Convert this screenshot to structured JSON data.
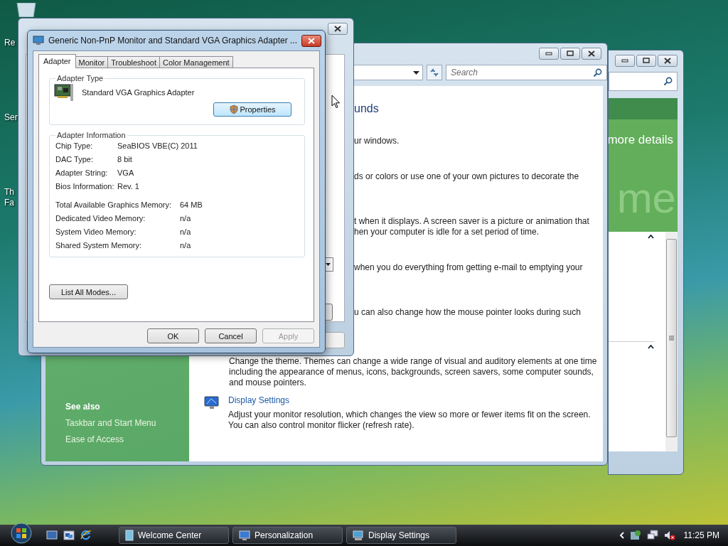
{
  "desktop": {
    "icons": [
      {
        "lines": [
          "Re"
        ]
      },
      {
        "lines": [
          "Ser"
        ]
      },
      {
        "lines": [
          "Th",
          "Fa"
        ]
      }
    ]
  },
  "welcome_window": {
    "banner_link": "more details",
    "banner_title": "me"
  },
  "personalization_window": {
    "search": {
      "placeholder": "Search"
    },
    "heading": "unds",
    "partial_blocks": [
      [
        "ur windows."
      ],
      [
        "ds or colors or use one of your own pictures to decorate the"
      ],
      [
        "t when it displays. A screen saver is a picture or animation that",
        "hen your computer is idle for a set period of time."
      ],
      [
        "when you do everything from getting e-mail to emptying your"
      ],
      [
        "u can also change how the mouse pointer looks during such"
      ]
    ],
    "theme_description": [
      "Change the theme. Themes can change a wide range of visual and auditory elements at one time",
      "including the appearance of menus, icons, backgrounds, screen savers, some computer sounds,",
      "and mouse pointers."
    ],
    "display_settings": {
      "link": "Display Settings",
      "description": [
        "Adjust your monitor resolution, which changes the view so more or fewer items fit on the screen.",
        "You can also control monitor flicker (refresh rate)."
      ]
    },
    "see_also": {
      "title": "See also",
      "links": [
        "Taskbar and Start Menu",
        "Ease of Access"
      ]
    }
  },
  "dialog": {
    "title": "Generic Non-PnP Monitor and Standard VGA Graphics Adapter ...",
    "tabs": [
      {
        "label": "Adapter",
        "selected": true
      },
      {
        "label": "Monitor",
        "selected": false
      },
      {
        "label": "Troubleshoot",
        "selected": false
      },
      {
        "label": "Color Management",
        "selected": false
      }
    ],
    "adapter_type": {
      "group_title": "Adapter Type",
      "name": "Standard VGA Graphics Adapter",
      "properties_button": "Properties"
    },
    "adapter_info": {
      "group_title": "Adapter Information",
      "rows": [
        {
          "label": "Chip Type:",
          "value": "SeaBIOS VBE(C) 2011"
        },
        {
          "label": "DAC Type:",
          "value": "8 bit"
        },
        {
          "label": "Adapter String:",
          "value": "VGA"
        },
        {
          "label": "Bios Information:",
          "value": "Rev. 1"
        }
      ],
      "memory_rows": [
        {
          "label": "Total Available Graphics Memory:",
          "value": "64 MB"
        },
        {
          "label": "Dedicated Video Memory:",
          "value": "n/a"
        },
        {
          "label": "System Video Memory:",
          "value": "n/a"
        },
        {
          "label": "Shared System Memory:",
          "value": "n/a"
        }
      ]
    },
    "list_modes_button": "List All Modes...",
    "buttons": [
      {
        "label": "OK",
        "disabled": false
      },
      {
        "label": "Cancel",
        "disabled": false
      },
      {
        "label": "Apply",
        "disabled": true
      }
    ]
  },
  "taskbar": {
    "tasks": [
      {
        "label": "Welcome Center",
        "kind": "welcome"
      },
      {
        "label": "Personalization",
        "kind": "personalize"
      },
      {
        "label": "Display Settings",
        "kind": "display"
      }
    ],
    "clock": "11:25 PM"
  }
}
